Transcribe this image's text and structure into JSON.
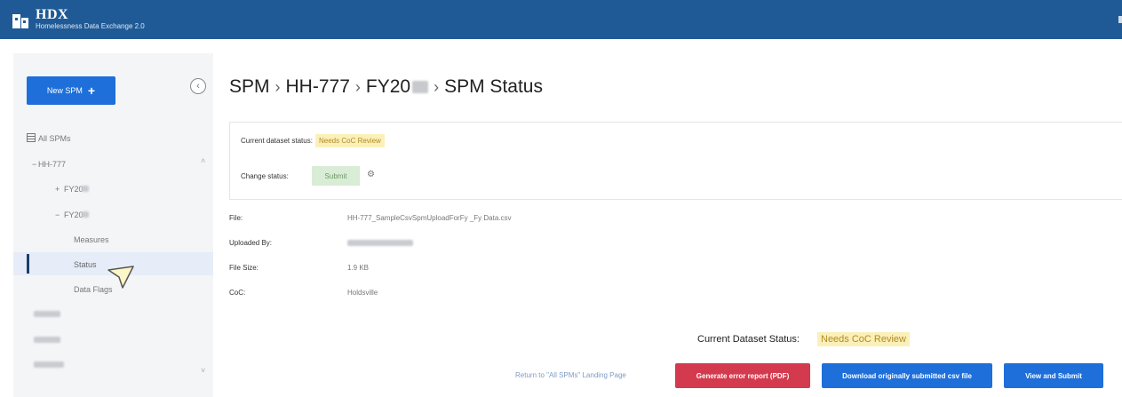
{
  "app": {
    "logo_title": "HDX",
    "logo_subtitle": "Homelessness Data Exchange 2.0"
  },
  "sidebar": {
    "new_button_label": "New SPM",
    "all_spms_label": "All SPMs",
    "tree": {
      "hh777": "HH-777",
      "fy_a": "FY20",
      "fy_b": "FY20",
      "measures": "Measures",
      "status": "Status",
      "data_flags": "Data Flags"
    }
  },
  "breadcrumb": {
    "root": "SPM",
    "coc": "HH-777",
    "fiscal_year": "FY20",
    "page": "SPM Status"
  },
  "status_panel": {
    "current_label": "Current dataset status:",
    "current_value": "Needs CoC Review",
    "change_label": "Change status:",
    "submit_label": "Submit"
  },
  "file_info": {
    "file_label": "File:",
    "file_value": "HH-777_SampleCsvSpmUploadForFy  _Fy  Data.csv",
    "uploaded_by_label": "Uploaded By:",
    "file_size_label": "File Size:",
    "file_size_value": "1.9 KB",
    "coc_label": "CoC:",
    "coc_value": "Holdsville"
  },
  "footer": {
    "current_status_label": "Current Dataset Status:",
    "current_status_value": "Needs CoC Review",
    "return_link": "Return to \"All SPMs\" Landing Page",
    "btn_error_report": "Generate error report (PDF)",
    "btn_download": "Download originally submitted csv file",
    "btn_view_submit": "View and Submit"
  },
  "colors": {
    "header_bg": "#1f5a96",
    "primary_blue": "#1e6fd9",
    "danger_red": "#d43a4e",
    "badge_yellow": "#fbf0b8",
    "submit_green": "#d9ecd6"
  }
}
